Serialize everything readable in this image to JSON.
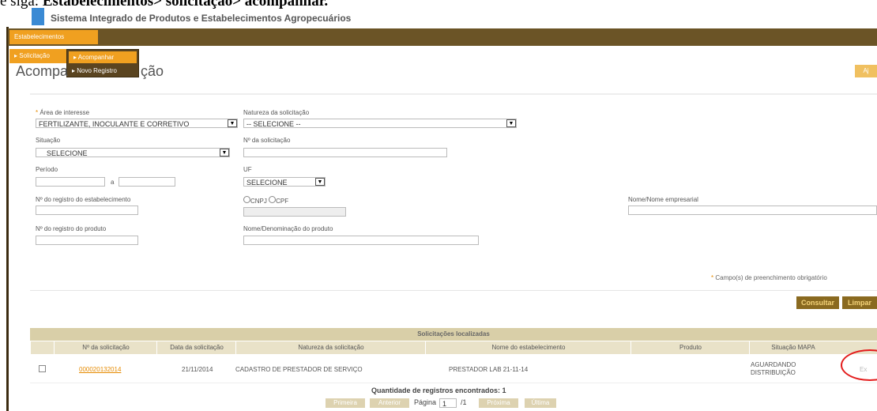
{
  "caption": {
    "prefix": "e siga: ",
    "bold": "Estabelecimentos> solicitação> acompanhar."
  },
  "app": {
    "title": "Sistema Integrado de Produtos e Estabelecimentos Agropecuários"
  },
  "menu": {
    "estabelecimentos": "Estabelecimentos",
    "solicitacao": "Solicitação",
    "submenu": [
      "Acompanhar",
      "Novo Registro"
    ]
  },
  "page": {
    "title_prefix": "Acompa",
    "title_suffix": "ção",
    "corner_button": "Aj"
  },
  "form": {
    "area_interesse_label": "Área de interesse",
    "area_interesse_value": "FERTILIZANTE, INOCULANTE E CORRETIVO",
    "natureza_label": "Natureza da solicitação",
    "natureza_value": "-- SELECIONE --",
    "situacao_label": "Situação",
    "situacao_value": "SELECIONE",
    "num_solicitacao_label": "Nº da solicitação",
    "periodo_label": "Período",
    "periodo_sep": "a",
    "uf_label": "UF",
    "uf_value": "SELECIONE",
    "registro_estab_label": "Nº do registro do estabelecimento",
    "cnpj_label": "CNPJ",
    "cpf_label": "CPF",
    "nome_empresarial_label": "Nome/Nome empresarial",
    "registro_produto_label": "Nº do registro do produto",
    "nome_produto_label": "Nome/Denominação do produto",
    "required_note": "Campo(s) de preenchimento obrigatório",
    "consultar_button": "Consultar",
    "limpar_button": "Limpar"
  },
  "results": {
    "title": "Solicitações localizadas",
    "columns": [
      "Nº da solicitação",
      "Data da solicitação",
      "Natureza da solicitação",
      "Nome do estabelecimento",
      "Produto",
      "Situação MAPA"
    ],
    "rows": [
      {
        "numero": "000020132014",
        "data": "21/11/2014",
        "natureza": "CADASTRO DE PRESTADOR DE SERVIÇO",
        "estabelecimento": "PRESTADOR LAB 21-11-14",
        "produto": "",
        "situacao": "AGUARDANDO DISTRIBUIÇÃO",
        "action": "Ex"
      }
    ],
    "count_label": "Quantidade de registros encontrados:",
    "count_value": "1",
    "pager": {
      "first": "Primeira",
      "prev": "Anterior",
      "page_label": "Página",
      "page_value": "1",
      "total": "/1",
      "next": "Próxima",
      "last": "Última"
    }
  },
  "colors": {
    "menu_bar": "#6b5426",
    "accent": "#f0a020",
    "button_bg": "#8a6a20",
    "highlight_circle": "#e31b1b"
  }
}
